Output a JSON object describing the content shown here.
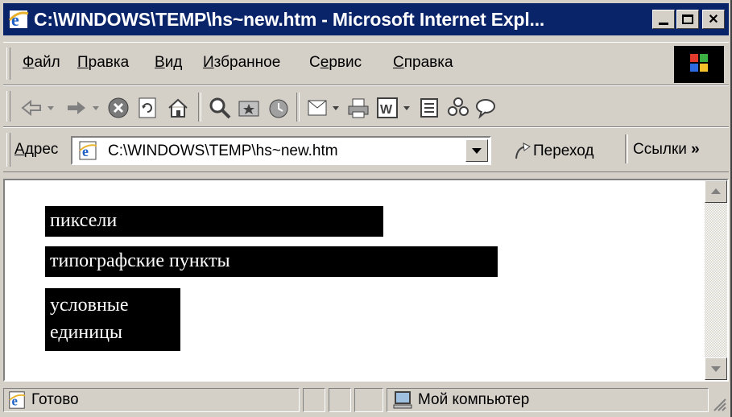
{
  "window": {
    "title": "C:\\WINDOWS\\TEMP\\hs~new.htm - Microsoft Internet Expl...",
    "title_color": "#0a246a"
  },
  "menu": {
    "items": [
      "Файл",
      "Правка",
      "Вид",
      "Избранное",
      "Сервис",
      "Справка"
    ],
    "accel": [
      "Ф",
      "П",
      "В",
      "И",
      "е",
      "С"
    ]
  },
  "toolbar": {
    "icons": [
      "back-arrow-icon",
      "forward-arrow-icon",
      "stop-icon",
      "refresh-icon",
      "home-icon",
      "search-icon",
      "favorites-icon",
      "history-icon",
      "mail-icon",
      "print-icon",
      "edit-word-icon",
      "discuss-icon",
      "messenger-icon",
      "chat-icon"
    ]
  },
  "address": {
    "label": "Адрес",
    "value": "C:\\WINDOWS\\TEMP\\hs~new.htm",
    "go_label": "Переход",
    "links_label": "Ссылки",
    "links_chevron": "»"
  },
  "page": {
    "blocks": [
      {
        "text": "пиксели"
      },
      {
        "text": "типографские пункты"
      },
      {
        "text_line1": "условные",
        "text_line2": "единицы"
      }
    ]
  },
  "statusbar": {
    "status_text": "Готово",
    "zone_text": "Мой компьютер"
  }
}
